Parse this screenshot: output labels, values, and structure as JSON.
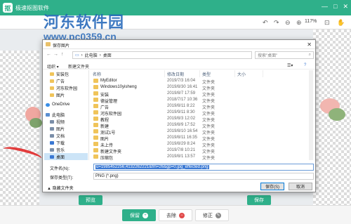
{
  "app": {
    "title": "极速抠图软件",
    "logo_text": "抠",
    "controls": [
      "—",
      "□",
      "✕"
    ]
  },
  "watermark": {
    "name": "河东软件园",
    "url": "www.pc0359.cn"
  },
  "toolbar": {
    "zoom": "117%"
  },
  "canvas_buttons": {
    "preview": "预览",
    "save": "保存"
  },
  "bottom": {
    "keep": "保留",
    "remove": "去除",
    "restore": "修正"
  },
  "dialog": {
    "title": "保存图片",
    "address": {
      "path_1": "此电脑",
      "path_2": "桌面"
    },
    "search_placeholder": "搜索\"桌面\"",
    "organize": "组织 ▾",
    "new_folder": "新建文件夹",
    "nav": [
      {
        "label": "安装包",
        "color": "#f0c45a"
      },
      {
        "label": "广告",
        "color": "#f0c45a"
      },
      {
        "label": "河东软件园",
        "color": "#f0c45a"
      },
      {
        "label": "图片",
        "color": "#f0c45a"
      },
      {
        "label": "OneDrive",
        "color": "#3a8ee6"
      },
      {
        "label": "此电脑",
        "color": "#5b8fd1"
      },
      {
        "label": "视频",
        "color": "#7a8ea8"
      },
      {
        "label": "图片",
        "color": "#7a8ea8"
      },
      {
        "label": "文档",
        "color": "#7a8ea8"
      },
      {
        "label": "下载",
        "color": "#3a78d3"
      },
      {
        "label": "音乐",
        "color": "#7a8ea8"
      },
      {
        "label": "桌面",
        "color": "#3a78d3"
      }
    ],
    "columns": {
      "name": "名称",
      "date": "修改日期",
      "type": "类型",
      "size": "大小"
    },
    "files": [
      {
        "name": "MyEditor",
        "date": "2019/7/3 16:04",
        "type": "文件夹"
      },
      {
        "name": "Windows10yisheng",
        "date": "2019/8/30 16:41",
        "type": "文件夹"
      },
      {
        "name": "安装",
        "date": "2019/8/7 17:59",
        "type": "文件夹"
      },
      {
        "name": "德益管理",
        "date": "2018/7/17 10:36",
        "type": "文件夹"
      },
      {
        "name": "广告",
        "date": "2019/8/11 8:22",
        "type": "文件夹"
      },
      {
        "name": "河东软件园",
        "date": "2019/9/11 8:30",
        "type": "文件夹"
      },
      {
        "name": "教程",
        "date": "2019/8/3 12:02",
        "type": "文件夹"
      },
      {
        "name": "新建",
        "date": "2019/8/9 17:52",
        "type": "文件夹"
      },
      {
        "name": "测试1号",
        "date": "2019/8/10 16:54",
        "type": "文件夹"
      },
      {
        "name": "图片",
        "date": "2019/8/11 16:35",
        "type": "文件夹"
      },
      {
        "name": "未上传",
        "date": "2019/8/29 8:24",
        "type": "文件夹"
      },
      {
        "name": "新建文件夹",
        "date": "2019/7/8 10:21",
        "type": "文件夹"
      },
      {
        "name": "压缩包",
        "date": "2019/8/1 13:57",
        "type": "文件夹"
      }
    ],
    "filename_label": "文件名(N):",
    "filename_value": "u=1985452256,4132262221&fm=26&gp=0.jpg_effected.png",
    "filetype_label": "保存类型(T):",
    "filetype_value": "PNG (*.png)",
    "hide_folders": "▲ 隐藏文件夹",
    "save_button": "保存(S)",
    "cancel_button": "取消"
  }
}
